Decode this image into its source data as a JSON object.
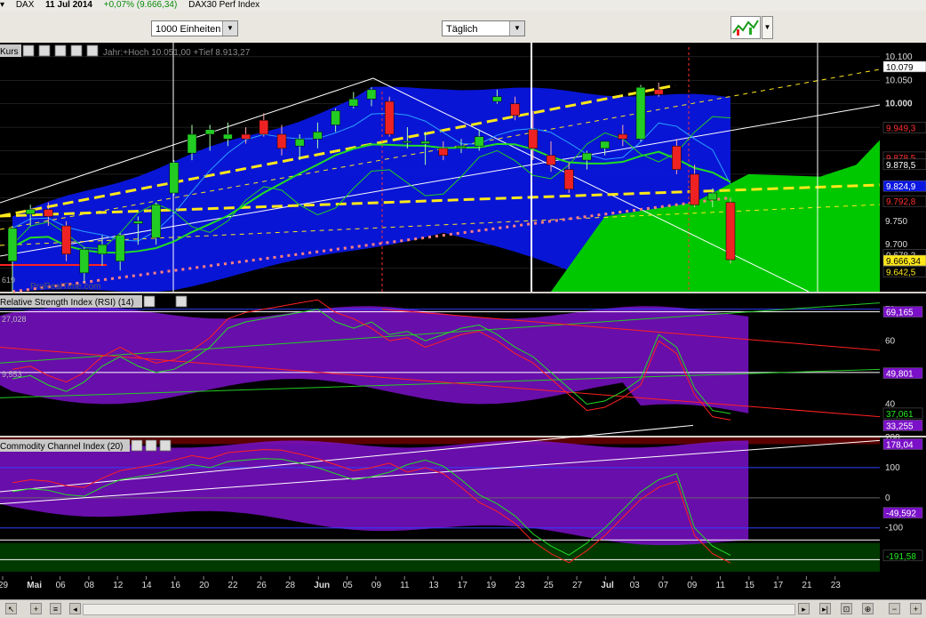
{
  "titlebar": {
    "symbol": "DAX",
    "date": "11 Jul 2014",
    "change": "+0,07% (9.666,34)",
    "name": "DAX30 Perf Index"
  },
  "toolbar": {
    "units_value": "1000 Einheiten",
    "period_value": "Täglich"
  },
  "colors": {
    "up": "#22cc22",
    "down": "#ee2222",
    "band": "#0a16e0",
    "cloud": "#00c800",
    "rsi_band": "#7a10c8",
    "cci_band": "#7a10c8",
    "trend_yellow": "#ffe81a",
    "grid": "#3a3a3a"
  },
  "price_panel": {
    "title": "Kurs",
    "hilo_label": "Jahr:+Hoch 10.051,00 +Tief 8.913,27",
    "left_value": "619",
    "watermark": "ProRealTime.com",
    "axis_ticks": [
      "10.100",
      "10.050",
      "10.000",
      "9.750",
      "9.700"
    ],
    "value_tags": [
      {
        "text": "10.079",
        "bg": "#ffffff",
        "fg": "#000000",
        "v": 10079
      },
      {
        "text": "9.949,3",
        "bg": "#000000",
        "fg": "#ff3030",
        "v": 9949.3
      },
      {
        "text": "9.878,5",
        "bg": "#000000",
        "fg": "#ff3030",
        "v": 9886
      },
      {
        "text": "9.878,5",
        "bg": "#000000",
        "fg": "#ffffff",
        "v": 9871
      },
      {
        "text": "9.824,9",
        "bg": "#0a16e0",
        "fg": "#ffffff",
        "v": 9824.9
      },
      {
        "text": "9.792,8",
        "bg": "#000000",
        "fg": "#ff3030",
        "v": 9792.8
      },
      {
        "text": "9.678,3",
        "bg": "#000000",
        "fg": "#dddddd",
        "v": 9678.3
      },
      {
        "text": "9.666,34",
        "bg": "#ffe81a",
        "fg": "#000000",
        "v": 9666.34
      },
      {
        "text": "9.642,5",
        "bg": "#000000",
        "fg": "#ffe81a",
        "v": 9642.5
      }
    ]
  },
  "rsi_panel": {
    "title": "Relative Strength Index (RSI) (14)",
    "left_value": "27,028",
    "left_value2": "9,553",
    "axis_ticks": [
      "70",
      "60",
      "50",
      "40"
    ],
    "value_tags": [
      {
        "text": "69,165",
        "bg": "#7a10c8",
        "fg": "#ffffff",
        "v": 69.2
      },
      {
        "text": "49,801",
        "bg": "#7a10c8",
        "fg": "#ffffff",
        "v": 49.8
      },
      {
        "text": "37,061",
        "bg": "#000000",
        "fg": "#22ee22",
        "v": 37.06
      },
      {
        "text": "33,255",
        "bg": "#7a10c8",
        "fg": "#ffffff",
        "v": 33.26
      }
    ]
  },
  "cci_panel": {
    "title": "Commodity Channel Index (20)",
    "axis_ticks": [
      "200",
      "100",
      "0",
      "-100"
    ],
    "value_tags": [
      {
        "text": "178,04",
        "bg": "#7a10c8",
        "fg": "#ffffff",
        "v": 178
      },
      {
        "text": "-49,592",
        "bg": "#7a10c8",
        "fg": "#ffffff",
        "v": -49.6
      },
      {
        "text": "-191,58",
        "bg": "#000000",
        "fg": "#22ee22",
        "v": -191.58
      }
    ]
  },
  "chart_data": {
    "type": "candlestick",
    "title": "DAX30 Perf Index",
    "x_tick_labels": [
      "29",
      "Mai",
      "06",
      "08",
      "12",
      "14",
      "16",
      "20",
      "22",
      "26",
      "28",
      "Jun",
      "05",
      "09",
      "11",
      "13",
      "17",
      "19",
      "23",
      "25",
      "27",
      "Jul",
      "03",
      "07",
      "09",
      "11",
      "15",
      "17",
      "21",
      "23"
    ],
    "price_ylim": [
      9600,
      10130
    ],
    "candles": [
      {
        "o": 9665,
        "h": 9740,
        "l": 9595,
        "c": 9735
      },
      {
        "o": 9765,
        "h": 9785,
        "l": 9740,
        "c": 9775
      },
      {
        "o": 9775,
        "h": 9790,
        "l": 9740,
        "c": 9760
      },
      {
        "o": 9740,
        "h": 9750,
        "l": 9665,
        "c": 9680
      },
      {
        "o": 9640,
        "h": 9695,
        "l": 9620,
        "c": 9690
      },
      {
        "o": 9680,
        "h": 9720,
        "l": 9655,
        "c": 9700
      },
      {
        "o": 9665,
        "h": 9725,
        "l": 9645,
        "c": 9720
      },
      {
        "o": 9745,
        "h": 9760,
        "l": 9700,
        "c": 9750
      },
      {
        "o": 9715,
        "h": 9790,
        "l": 9700,
        "c": 9785
      },
      {
        "o": 9810,
        "h": 9880,
        "l": 9805,
        "c": 9875
      },
      {
        "o": 9895,
        "h": 9955,
        "l": 9880,
        "c": 9935
      },
      {
        "o": 9935,
        "h": 9955,
        "l": 9900,
        "c": 9945
      },
      {
        "o": 9925,
        "h": 9960,
        "l": 9910,
        "c": 9935
      },
      {
        "o": 9935,
        "h": 9950,
        "l": 9915,
        "c": 9925
      },
      {
        "o": 9965,
        "h": 9980,
        "l": 9930,
        "c": 9935
      },
      {
        "o": 9935,
        "h": 9955,
        "l": 9890,
        "c": 9905
      },
      {
        "o": 9910,
        "h": 9935,
        "l": 9880,
        "c": 9925
      },
      {
        "o": 9925,
        "h": 9960,
        "l": 9905,
        "c": 9940
      },
      {
        "o": 9955,
        "h": 9990,
        "l": 9940,
        "c": 9985
      },
      {
        "o": 9995,
        "h": 10025,
        "l": 9990,
        "c": 10010
      },
      {
        "o": 10010,
        "h": 10035,
        "l": 9995,
        "c": 10030
      },
      {
        "o": 10005,
        "h": 10015,
        "l": 9930,
        "c": 9935
      },
      {
        "o": 9920,
        "h": 9950,
        "l": 9905,
        "c": 9920
      },
      {
        "o": 9915,
        "h": 9940,
        "l": 9870,
        "c": 9920
      },
      {
        "o": 9905,
        "h": 9920,
        "l": 9880,
        "c": 9890
      },
      {
        "o": 9905,
        "h": 9925,
        "l": 9895,
        "c": 9910
      },
      {
        "o": 9910,
        "h": 9945,
        "l": 9900,
        "c": 9930
      },
      {
        "o": 10005,
        "h": 10030,
        "l": 10000,
        "c": 10015
      },
      {
        "o": 10000,
        "h": 10015,
        "l": 9965,
        "c": 9975
      },
      {
        "o": 9945,
        "h": 9985,
        "l": 9880,
        "c": 9905
      },
      {
        "o": 9890,
        "h": 9920,
        "l": 9855,
        "c": 9870
      },
      {
        "o": 9860,
        "h": 9875,
        "l": 9810,
        "c": 9818
      },
      {
        "o": 9880,
        "h": 9900,
        "l": 9860,
        "c": 9895
      },
      {
        "o": 9905,
        "h": 9920,
        "l": 9890,
        "c": 9920
      },
      {
        "o": 9935,
        "h": 9955,
        "l": 9910,
        "c": 9925
      },
      {
        "o": 9925,
        "h": 10040,
        "l": 9920,
        "c": 10035
      },
      {
        "o": 10030,
        "h": 10045,
        "l": 10015,
        "c": 10020
      },
      {
        "o": 9910,
        "h": 9925,
        "l": 9850,
        "c": 9860
      },
      {
        "o": 9850,
        "h": 9870,
        "l": 9780,
        "c": 9785
      },
      {
        "o": 9795,
        "h": 9820,
        "l": 9780,
        "c": 9810
      },
      {
        "o": 9790,
        "h": 9800,
        "l": 9660,
        "c": 9668
      }
    ],
    "rsi": [
      48,
      49,
      46,
      44,
      47,
      52,
      55,
      52,
      50,
      51,
      54,
      58,
      64,
      66,
      67,
      68,
      69,
      70,
      66,
      64,
      66,
      62,
      63,
      60,
      62,
      64,
      65,
      62,
      58,
      55,
      50,
      45,
      40,
      41,
      44,
      48,
      62,
      58,
      45,
      38,
      37
    ],
    "cci": [
      20,
      30,
      25,
      10,
      5,
      35,
      60,
      70,
      80,
      95,
      110,
      100,
      120,
      125,
      130,
      128,
      115,
      100,
      80,
      60,
      70,
      85,
      110,
      125,
      105,
      60,
      10,
      -20,
      -60,
      -120,
      -160,
      -190,
      -150,
      -100,
      -40,
      20,
      60,
      80,
      -100,
      -160,
      -191
    ]
  }
}
